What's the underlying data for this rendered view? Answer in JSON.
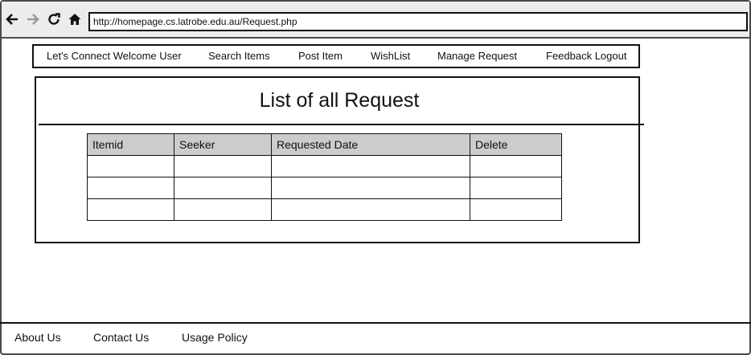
{
  "browser": {
    "url": "http://homepage.cs.latrobe.edu.au/Request.php",
    "buttons": [
      "back-icon",
      "forward-icon",
      "reload-icon",
      "home-icon"
    ]
  },
  "nav": {
    "brand": "Let's Connect Welcome User",
    "search_items": "Search Items",
    "post_item": "Post Item",
    "wishlist": "WishList",
    "manage_request": "Manage Request",
    "feedback_logout": "Feedback Logout"
  },
  "main": {
    "title": "List of all Request",
    "table": {
      "columns": [
        "Itemid",
        "Seeker",
        "Requested Date",
        "Delete"
      ],
      "rows": [
        [
          "",
          "",
          "",
          ""
        ],
        [
          "",
          "",
          "",
          ""
        ],
        [
          "",
          "",
          "",
          ""
        ]
      ]
    }
  },
  "footer": {
    "about": "About Us",
    "contact": "Contact Us",
    "usage": "Usage Policy"
  },
  "colors": {
    "border": "#111111",
    "browser_bar": "#ececec",
    "table_header": "#cccccc"
  }
}
